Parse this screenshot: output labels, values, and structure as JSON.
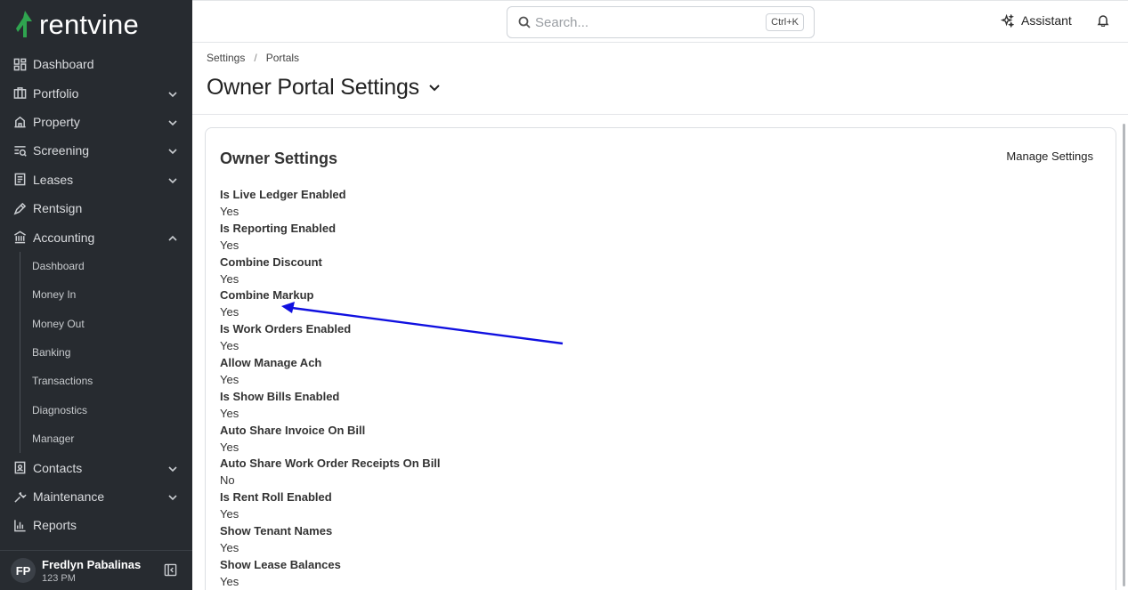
{
  "brand": {
    "name": "rentvine",
    "accent": "#2fa44f"
  },
  "sidebar": {
    "items": [
      {
        "label": "Dashboard",
        "icon": "dashboard-icon",
        "expandable": false
      },
      {
        "label": "Portfolio",
        "icon": "portfolio-icon",
        "expandable": true
      },
      {
        "label": "Property",
        "icon": "property-icon",
        "expandable": true
      },
      {
        "label": "Screening",
        "icon": "screening-icon",
        "expandable": true
      },
      {
        "label": "Leases",
        "icon": "leases-icon",
        "expandable": true
      },
      {
        "label": "Rentsign",
        "icon": "rentsign-icon",
        "expandable": false
      },
      {
        "label": "Accounting",
        "icon": "accounting-icon",
        "expandable": true,
        "expanded": true
      }
    ],
    "accounting_sub": [
      "Dashboard",
      "Money In",
      "Money Out",
      "Banking",
      "Transactions",
      "Diagnostics",
      "Manager"
    ],
    "items_after": [
      {
        "label": "Contacts",
        "icon": "contacts-icon",
        "expandable": true
      },
      {
        "label": "Maintenance",
        "icon": "maintenance-icon",
        "expandable": true
      },
      {
        "label": "Reports",
        "icon": "reports-icon",
        "expandable": false
      }
    ],
    "user": {
      "initials": "FP",
      "name": "Fredlyn Pabalinas",
      "sub": "123 PM"
    }
  },
  "topbar": {
    "search_placeholder": "Search...",
    "shortcut": "Ctrl+K",
    "assistant_label": "Assistant"
  },
  "header": {
    "breadcrumb": [
      "Settings",
      "Portals"
    ],
    "title": "Owner Portal Settings"
  },
  "card": {
    "title": "Owner Settings",
    "manage_label": "Manage Settings",
    "fields": [
      {
        "label": "Is Live Ledger Enabled",
        "value": "Yes"
      },
      {
        "label": "Is Reporting Enabled",
        "value": "Yes"
      },
      {
        "label": "Combine Discount",
        "value": "Yes"
      },
      {
        "label": "Combine Markup",
        "value": "Yes"
      },
      {
        "label": "Is Work Orders Enabled",
        "value": "Yes"
      },
      {
        "label": "Allow Manage Ach",
        "value": "Yes"
      },
      {
        "label": "Is Show Bills Enabled",
        "value": "Yes"
      },
      {
        "label": "Auto Share Invoice On Bill",
        "value": "Yes"
      },
      {
        "label": "Auto Share Work Order Receipts On Bill",
        "value": "No"
      },
      {
        "label": "Is Rent Roll Enabled",
        "value": "Yes"
      },
      {
        "label": "Show Tenant Names",
        "value": "Yes"
      },
      {
        "label": "Show Lease Balances",
        "value": "Yes"
      }
    ]
  },
  "annotation": {
    "color": "#1010e0"
  }
}
